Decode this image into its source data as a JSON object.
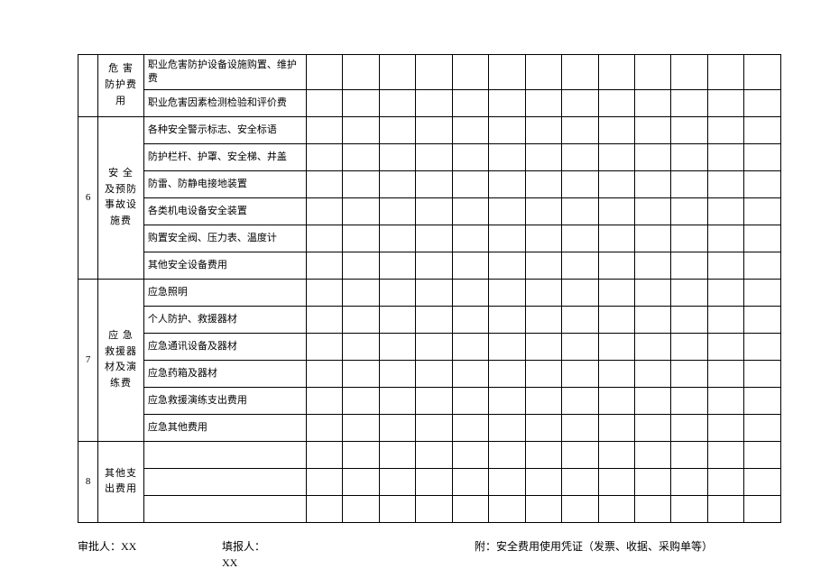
{
  "section5": {
    "category": "危 害防护费用",
    "items": [
      "职业危害防护设备设施购置、维护费",
      "职业危害因素检测检验和评价费"
    ]
  },
  "section6": {
    "num": "6",
    "category": "安 全及预防事故设施费",
    "items": [
      "各种安全警示标志、安全标语",
      "防护栏杆、护罩、安全梯、井盖",
      "防雷、防静电接地装置",
      "各类机电设备安全装置",
      "购置安全阀、压力表、温度计",
      "其他安全设备费用"
    ]
  },
  "section7": {
    "num": "7",
    "category": "应 急救援器材及演练费",
    "items": [
      "应急照明",
      "个人防护、救援器材",
      "应急通讯设备及器材",
      "应急药箱及器材",
      "应急救援演练支出费用",
      "应急其他费用"
    ]
  },
  "section8": {
    "num": "8",
    "category": "其他支出费用",
    "items": [
      "",
      "",
      ""
    ]
  },
  "footer": {
    "approver_label": "审批人：",
    "approver_value": "XX",
    "reporter_label": "填报人：",
    "reporter_value": "XX",
    "attachment_label": "附：安全费用使用凭证（发票、收据、采购单等）"
  }
}
